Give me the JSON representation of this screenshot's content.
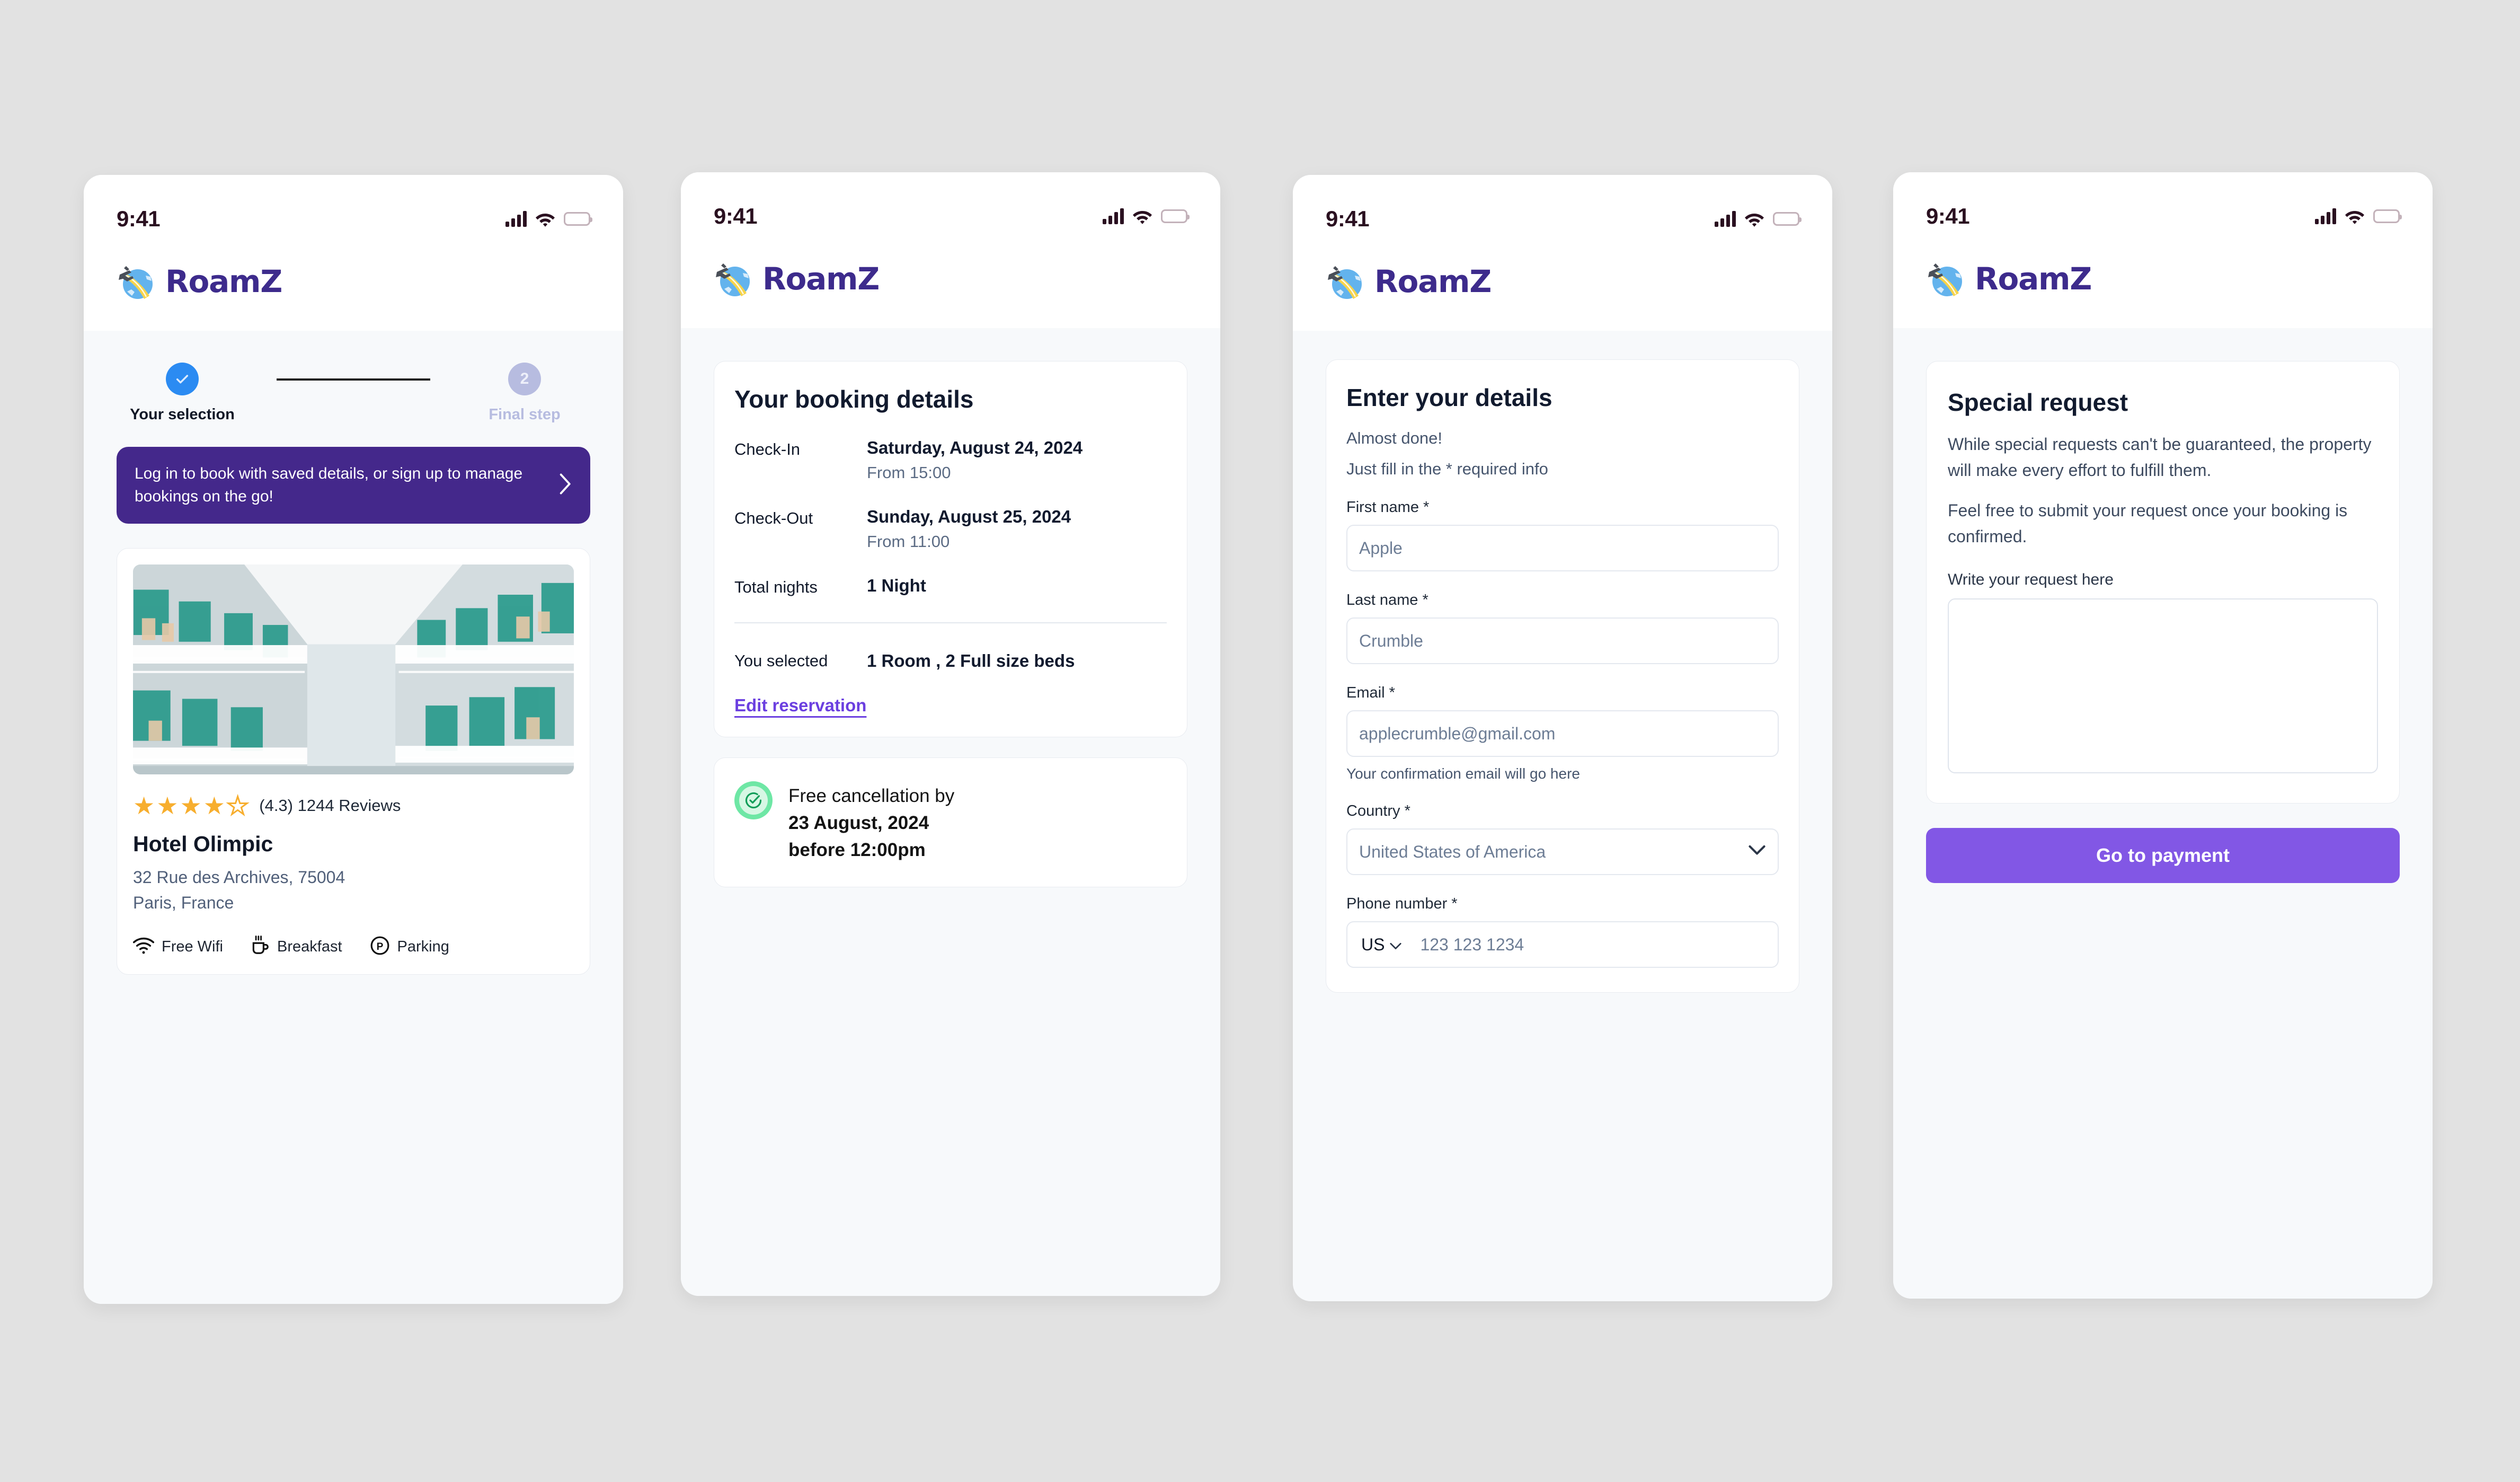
{
  "theme": {
    "page_background": "#e2e2e2",
    "brand_purple": "#3d2b8c",
    "banner_purple": "#44288b",
    "accent_purple": "#8257e5",
    "link_purple": "#6b3fe0",
    "step_blue": "#2b8bf2",
    "success_green": "#6ee7a5",
    "star_gold": "#f7ae2e"
  },
  "status_bar": {
    "time": "9:41",
    "icons": [
      "signal-icon",
      "wifi-icon",
      "battery-icon"
    ]
  },
  "brand": {
    "name": "RoamZ",
    "logo_icon": "globe-airplane-icon"
  },
  "screen1": {
    "stepper": {
      "steps": [
        {
          "marker": "check-icon",
          "label": "Your selection",
          "state": "done"
        },
        {
          "marker": "2",
          "label": "Final step",
          "state": "pending"
        }
      ]
    },
    "login_banner": {
      "text": "Log in to book with saved details, or sign up to manage bookings on the go!",
      "chevron": "chevron-right-icon"
    },
    "hotel": {
      "photo_alt": "hotel-courtyard-photo",
      "rating_value": "(4.3)",
      "review_count": "1244 Reviews",
      "stars_filled": 4,
      "stars_total": 5,
      "name": "Hotel Olimpic",
      "address_line1": "32 Rue des Archives, 75004",
      "address_line2": "Paris, France",
      "amenities": [
        {
          "icon": "wifi-icon",
          "label": "Free Wifi"
        },
        {
          "icon": "coffee-cup-icon",
          "label": "Breakfast"
        },
        {
          "icon": "parking-p-icon",
          "label": "Parking"
        }
      ]
    }
  },
  "screen2": {
    "booking": {
      "title": "Your booking details",
      "rows": [
        {
          "label": "Check-In",
          "value": "Saturday, August 24, 2024",
          "sub": "From 15:00"
        },
        {
          "label": "Check-Out",
          "value": "Sunday, August 25, 2024",
          "sub": "From 11:00"
        },
        {
          "label": "Total nights",
          "value": "1 Night",
          "sub": ""
        }
      ],
      "selection_label": "You selected",
      "selection_value": "1 Room , 2 Full size beds",
      "edit_link": "Edit reservation"
    },
    "cancellation": {
      "icon": "check-circle-icon",
      "line1": "Free cancellation by",
      "line2": "23 August, 2024",
      "line3": "before 12:00pm"
    }
  },
  "screen3": {
    "form": {
      "title": "Enter your details",
      "sub1": "Almost done!",
      "sub2": "Just fill in the * required info",
      "fields": [
        {
          "label": "First name *",
          "placeholder": "Apple",
          "name": "first-name"
        },
        {
          "label": "Last name *",
          "placeholder": "Crumble",
          "name": "last-name"
        },
        {
          "label": "Email *",
          "placeholder": "applecrumble@gmail.com",
          "name": "email",
          "help": "Your confirmation email will go here"
        }
      ],
      "country": {
        "label": "Country *",
        "value": "United States of America",
        "caret": "chevron-down-icon"
      },
      "phone": {
        "label": "Phone number *",
        "country_code": "US",
        "caret": "chevron-down-icon",
        "placeholder": "123 123 1234"
      }
    }
  },
  "screen4": {
    "special_request": {
      "title": "Special request",
      "para1": "While special requests can't be guaranteed, the property will make every effort to fulfill them.",
      "para2": "Feel free to submit your request once your booking is confirmed.",
      "field_label": "Write your request here",
      "textarea_value": ""
    },
    "pay_button": "Go to payment"
  }
}
